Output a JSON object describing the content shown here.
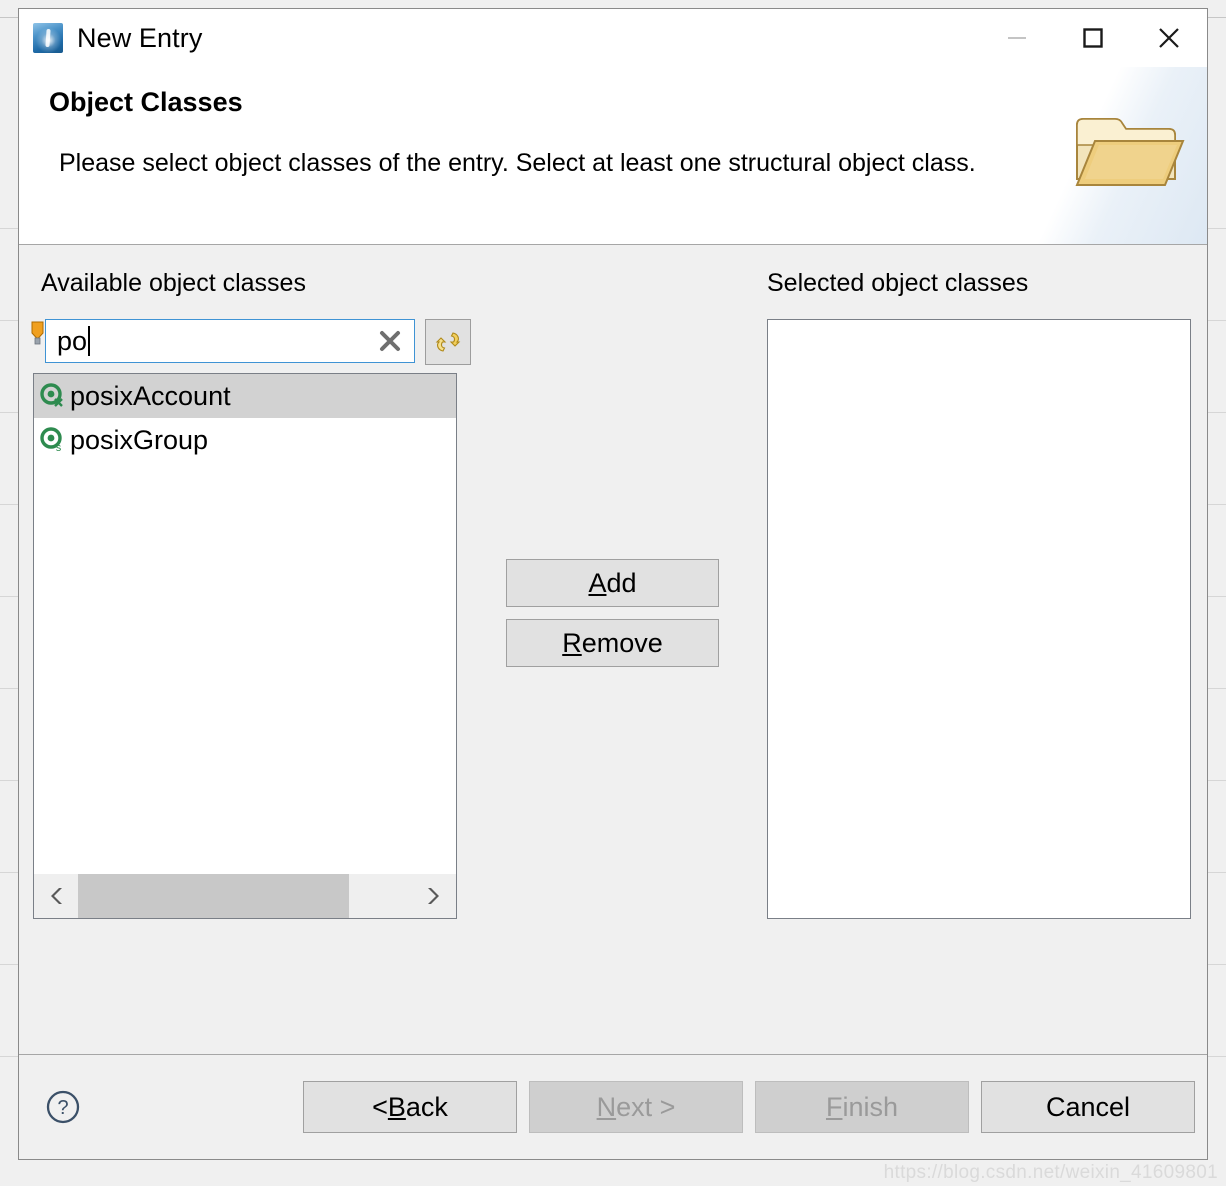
{
  "window": {
    "title": "New Entry",
    "app_icon": "directory-studio-icon",
    "minimize_label": "—",
    "maximize_label": "□",
    "close_label": "✕"
  },
  "header": {
    "title": "Object Classes",
    "description": "Please select object classes of the entry. Select at least one structural object class.",
    "banner_icon": "folder-icon"
  },
  "body": {
    "available_label": "Available object classes",
    "selected_label": "Selected object classes",
    "filter": {
      "value": "po",
      "placeholder": "",
      "assist_icon": "content-assist-bulb-icon",
      "clear_icon": "clear-x-icon",
      "refresh_icon": "refresh-sync-icon"
    },
    "available_items": [
      {
        "label": "posixAccount",
        "icon": "object-class-auxiliary-icon",
        "badge": "x",
        "selected": true
      },
      {
        "label": "posixGroup",
        "icon": "object-class-structural-icon",
        "badge": "s",
        "selected": false
      }
    ],
    "selected_items": [],
    "scrollbar": {
      "left_icon": "chevron-left-icon",
      "right_icon": "chevron-right-icon"
    },
    "add_label_mnemonic": "A",
    "add_label_rest": "dd",
    "remove_label_mnemonic": "R",
    "remove_label_rest": "emove"
  },
  "footer": {
    "help_icon": "help-question-icon",
    "back_prefix": "< ",
    "back_mnemonic": "B",
    "back_rest": "ack",
    "next_mnemonic": "N",
    "next_rest": "ext >",
    "finish_mnemonic": "F",
    "finish_rest": "inish",
    "cancel_label": "Cancel",
    "next_disabled": true,
    "finish_disabled": true
  },
  "watermark": "https://blog.csdn.net/weixin_41609801",
  "colors": {
    "dialog_bg": "#f0f0f0",
    "header_bg": "#ffffff",
    "focus_border": "#3f93d4",
    "selection": "#d2d2d2",
    "button_face": "#e1e1e1",
    "disabled_text": "#9a9a9a",
    "objectclass_green": "#2e8b4f",
    "folder_gold": "#e8c26a"
  }
}
